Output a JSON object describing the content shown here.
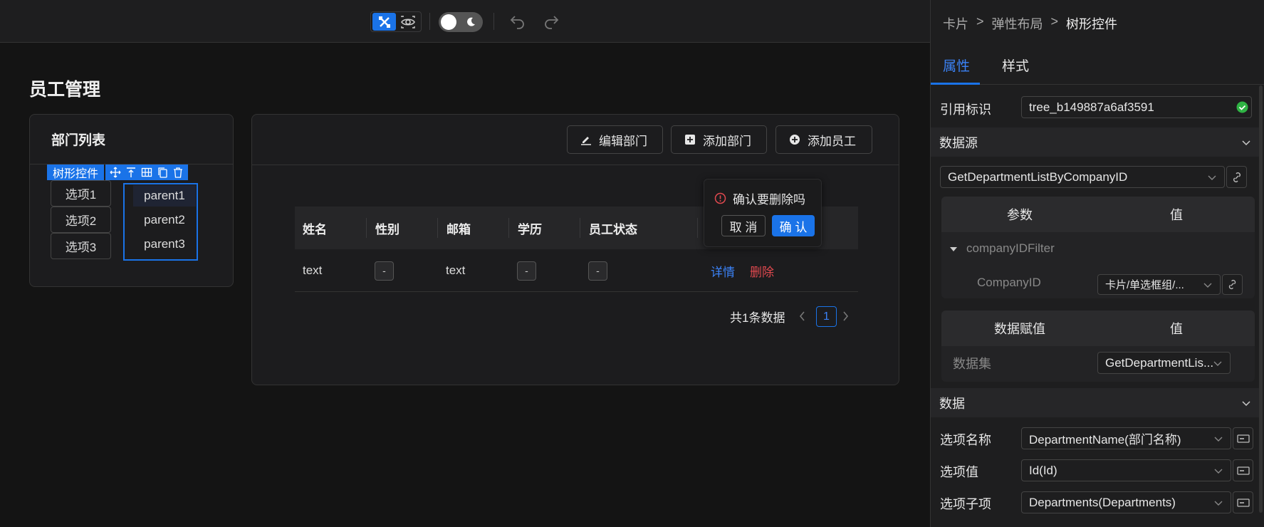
{
  "page": {
    "title": "员工管理"
  },
  "dept_card": {
    "title": "部门列表",
    "selected_component": "树形控件",
    "options": [
      "选项1",
      "选项2",
      "选项3"
    ],
    "tree_items": [
      "parent1",
      "parent2",
      "parent3"
    ]
  },
  "toolbar_actions": {
    "edit_dept": "编辑部门",
    "add_dept": "添加部门",
    "add_employee": "添加员工"
  },
  "table": {
    "columns": [
      "姓名",
      "性别",
      "邮箱",
      "学历",
      "员工状态"
    ],
    "row": {
      "name": "text",
      "gender": "-",
      "email": "text",
      "education": "-",
      "status": "-",
      "detail": "详情",
      "delete": "删除"
    },
    "total": "共1条数据",
    "page": "1"
  },
  "popconfirm": {
    "message": "确认要删除吗",
    "cancel": "取 消",
    "ok": "确 认"
  },
  "panel": {
    "breadcrumb": [
      "卡片",
      ">",
      "弹性布局",
      ">",
      "树形控件"
    ],
    "tabs": [
      "属性",
      "样式"
    ],
    "ref_label": "引用标识",
    "ref_value": "tree_b149887a6af3591",
    "datasource_title": "数据源",
    "datasource_value": "GetDepartmentListByCompanyID",
    "param_col": "参数",
    "value_col": "值",
    "param_group": "companyIDFilter",
    "param_name": "CompanyID",
    "param_value": "卡片/单选框组/...",
    "assign_col": "数据赋值",
    "assign_value_col": "值",
    "dataset_label": "数据集",
    "dataset_value": "GetDepartmentLis...",
    "data_title": "数据",
    "option_name_label": "选项名称",
    "option_name_value": "DepartmentName(部门名称)",
    "option_value_label": "选项值",
    "option_value_value": "Id(Id)",
    "option_children_label": "选项子项",
    "option_children_value": "Departments(Departments)"
  },
  "colors": {
    "accent": "#1a73e8",
    "danger": "#e0494f",
    "success": "#2fb344"
  }
}
